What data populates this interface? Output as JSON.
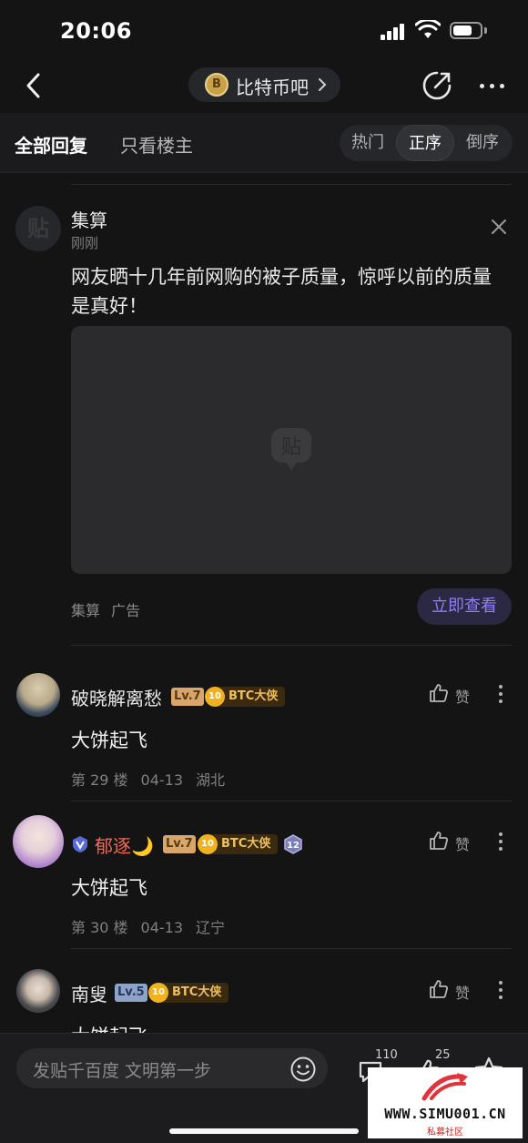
{
  "status_bar": {
    "time": "20:06",
    "battery_level": 0.7
  },
  "nav": {
    "forum_name": "比特币吧"
  },
  "filter": {
    "tabs": [
      "全部回复",
      "只看楼主"
    ],
    "sort_options": [
      "热门",
      "正序",
      "倒序"
    ],
    "active_sort": "正序"
  },
  "ad": {
    "account": "集算",
    "time": "刚刚",
    "text": "网友晒十几年前网购的被子质量，惊呼以前的质量是真好！",
    "source": "集算",
    "label": "广告",
    "cta": "立即查看"
  },
  "replies": [
    {
      "username": "破晓解离愁",
      "level": "Lv.7",
      "badge_level": "10",
      "badge": "BTC大侠",
      "like_label": "赞",
      "text": "大饼起飞",
      "floor": "第 29 楼",
      "date": "04-13",
      "location": "湖北"
    },
    {
      "username": "郁逐🌙",
      "level": "Lv.7",
      "badge_level": "10",
      "badge": "BTC大侠",
      "like_label": "赞",
      "text": "大饼起飞",
      "floor": "第 30 楼",
      "date": "04-13",
      "location": "辽宁"
    },
    {
      "username": "南叟",
      "level": "Lv.5",
      "badge_level": "10",
      "badge": "BTC大侠",
      "like_label": "赞",
      "text": "大饼起飞"
    }
  ],
  "bottom_bar": {
    "placeholder": "发贴千百度 文明第一步",
    "comment_count": "110",
    "like_count": "25"
  },
  "watermark": {
    "url": "WWW.SIMU001.CN",
    "sub": "私募社区"
  }
}
